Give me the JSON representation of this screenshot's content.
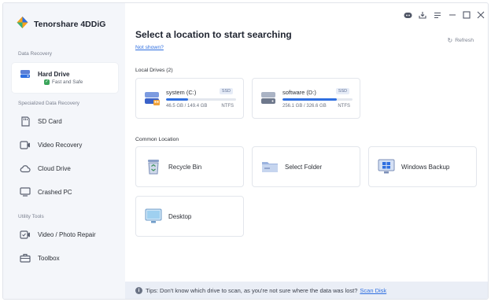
{
  "app": {
    "name": "Tenorshare 4DDiG"
  },
  "sidebar": {
    "sections": [
      "Data Recovery",
      "Specialized Data Recovery",
      "Utility Tools"
    ],
    "hard_drive": {
      "label": "Hard Drive",
      "status": "Fast and Safe"
    },
    "special_items": [
      "SD Card",
      "Video Recovery",
      "Cloud Drive",
      "Crashed PC"
    ],
    "utility_items": [
      "Video / Photo Repair",
      "Toolbox"
    ]
  },
  "main": {
    "title": "Select a location to start searching",
    "not_shown": "Not shown?",
    "refresh": "Refresh",
    "local_drives_label": "Local Drives (2)",
    "drives": [
      {
        "name": "system (C:)",
        "badge": "SSD",
        "usage": "46.5 GB / 149.4 GB",
        "fs": "NTFS",
        "used_fraction": 0.31
      },
      {
        "name": "software (D:)",
        "badge": "SSD",
        "usage": "256.1 GB / 326.6 GB",
        "fs": "NTFS",
        "used_fraction": 0.78
      }
    ],
    "common_location_label": "Common Location",
    "locations": [
      "Recycle Bin",
      "Select Folder",
      "Windows Backup",
      "Desktop"
    ]
  },
  "tips": {
    "text": "Tips: Don't know which drive to scan, as you're not sure where the data was lost?",
    "link": "Scan Disk"
  },
  "colors": {
    "accent": "#2f6fe0",
    "sidebar_bg": "#f4f6fa",
    "tips_bg": "#eaeef6"
  }
}
